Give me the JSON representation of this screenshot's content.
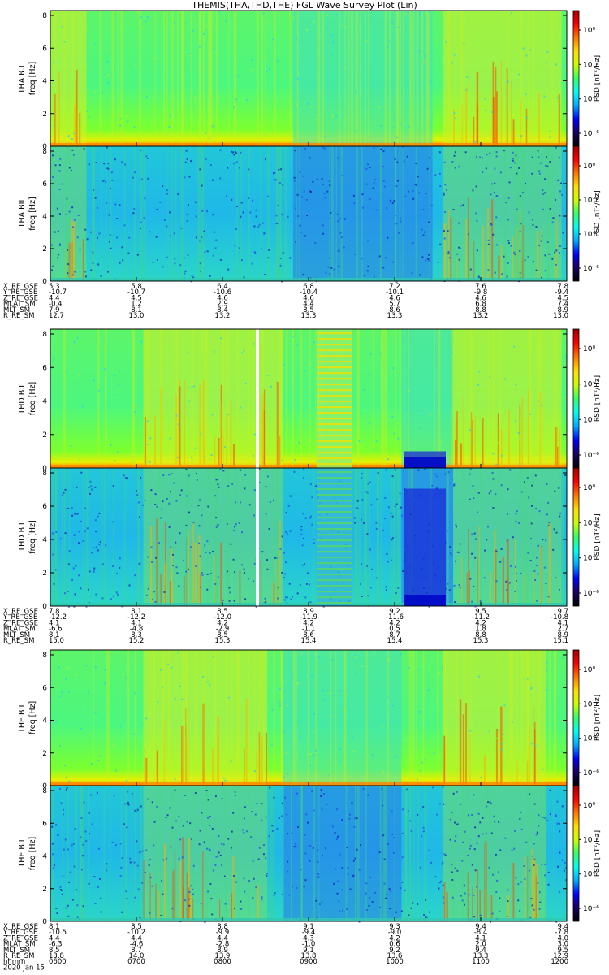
{
  "title": "THEMIS(THA,THD,THE) FGL Wave Survey Plot (Lin)",
  "colors": {
    "axis": "#000000",
    "background": "#ffffff"
  },
  "colorbar_stops": [
    "#000000",
    "#1a0060",
    "#0000ff",
    "#00aaff",
    "#00ffee",
    "#33ff66",
    "#ccff00",
    "#ffdd00",
    "#ff7700",
    "#ff0000",
    "#9b0000"
  ],
  "probes": [
    {
      "name": "THA",
      "panels": [
        {
          "label": "THA B.L",
          "ylabel": "freq [Hz]",
          "cbar_label": "PSD [nT²/Hz]",
          "cbar_ticks": [
            "10⁰",
            "10⁻²",
            "10⁻⁴",
            "10⁻⁶"
          ],
          "base": "high"
        },
        {
          "label": "THA BII",
          "ylabel": "freq [Hz]",
          "cbar_label": "PSD [nT²/Hz]",
          "cbar_ticks": [
            "10⁰",
            "10⁻²",
            "10⁻⁴",
            "10⁻⁶"
          ],
          "base": "low"
        }
      ],
      "ephemeris": [
        {
          "name": "X_RE_GSE",
          "values": [
            "5.3",
            "5.8",
            "6.4",
            "6.8",
            "7.2",
            "7.6",
            "7.8"
          ]
        },
        {
          "name": "Y_RE_GSE",
          "values": [
            "-10.7",
            "-10.7",
            "-10.6",
            "-10.4",
            "-10.1",
            "-9.8",
            "-9.4"
          ]
        },
        {
          "name": "Z_RE_GSE",
          "values": [
            "4.4",
            "4.5",
            "4.6",
            "4.6",
            "4.6",
            "4.6",
            "4.5"
          ]
        },
        {
          "name": "MLAT_SM",
          "values": [
            "-0.4",
            "1.2",
            "2.9",
            "4.4",
            "5.7",
            "6.8",
            "7.4"
          ]
        },
        {
          "name": "MLT_SM",
          "values": [
            "7.9",
            "8.1",
            "8.4",
            "8.5",
            "8.6",
            "8.8",
            "8.9"
          ]
        },
        {
          "name": "R_RE_SM",
          "values": [
            "12.7",
            "13.0",
            "13.2",
            "13.3",
            "13.3",
            "13.2",
            "13.0"
          ]
        }
      ]
    },
    {
      "name": "THD",
      "panels": [
        {
          "label": "THD B.L",
          "ylabel": "freq [Hz]",
          "cbar_label": "PSD [nT²/Hz]",
          "cbar_ticks": [
            "10⁰",
            "10⁻²",
            "10⁻⁴",
            "10⁻⁶"
          ],
          "base": "high"
        },
        {
          "label": "THD BII",
          "ylabel": "freq [Hz]",
          "cbar_label": "PSD [nT²/Hz]",
          "cbar_ticks": [
            "10⁰",
            "10⁻²",
            "10⁻⁴",
            "10⁻⁶"
          ],
          "base": "low"
        }
      ],
      "ephemeris": [
        {
          "name": "X_RE_GSE",
          "values": [
            "7.8",
            "8.1",
            "8.5",
            "8.9",
            "9.2",
            "9.5",
            "9.7"
          ]
        },
        {
          "name": "Y_RE_GSE",
          "values": [
            "-12.2",
            "-12.2",
            "-12.0",
            "-11.9",
            "-11.6",
            "-11.2",
            "-10.8"
          ]
        },
        {
          "name": "Z_RE_GSE",
          "values": [
            "4.1",
            "4.1",
            "4.2",
            "4.2",
            "4.2",
            "4.2",
            "4.1"
          ]
        },
        {
          "name": "MLAT_SM",
          "values": [
            "-6.6",
            "-4.8",
            "-2.9",
            "-1.1",
            "0.5",
            "1.8",
            "2.7"
          ]
        },
        {
          "name": "MLT_SM",
          "values": [
            "8.1",
            "8.3",
            "8.5",
            "8.6",
            "8.7",
            "8.8",
            "8.9"
          ]
        },
        {
          "name": "R_RE_SM",
          "values": [
            "15.0",
            "15.2",
            "15.3",
            "15.4",
            "15.4",
            "15.3",
            "15.1"
          ]
        }
      ]
    },
    {
      "name": "THE",
      "panels": [
        {
          "label": "THE B.L",
          "ylabel": "freq [Hz]",
          "cbar_label": "PSD [nT²/Hz]",
          "cbar_ticks": [
            "10⁰",
            "10⁻²",
            "10⁻⁴",
            "10⁻⁶"
          ],
          "base": "high"
        },
        {
          "label": "THE BII",
          "ylabel": "freq [Hz]",
          "cbar_label": "PSD [nT²/Hz]",
          "cbar_ticks": [
            "10⁰",
            "10⁻²",
            "10⁻⁴",
            "10⁻⁶"
          ],
          "base": "low"
        }
      ],
      "ephemeris": [
        {
          "name": "X_RE_GSE",
          "values": [
            "8.1",
            "8.5",
            "8.8",
            "9.1",
            "9.3",
            "9.4",
            "9.4"
          ]
        },
        {
          "name": "Y_RE_GSE",
          "values": [
            "-10.5",
            "-10.2",
            "-9.9",
            "-9.4",
            "-9.0",
            "-8.4",
            "-7.8"
          ]
        },
        {
          "name": "Z_RE_GSE",
          "values": [
            "4.4",
            "4.4",
            "4.4",
            "4.3",
            "4.2",
            "4.1",
            "4.0"
          ]
        },
        {
          "name": "MLAT_SM",
          "values": [
            "-6.3",
            "-4.6",
            "-2.8",
            "-1.0",
            "0.6",
            "2.0",
            "3.0"
          ]
        },
        {
          "name": "MLT_SM",
          "values": [
            "8.5",
            "8.7",
            "8.9",
            "9.1",
            "9.2",
            "9.4",
            "9.5"
          ]
        },
        {
          "name": "R_RE_SM",
          "values": [
            "13.8",
            "14.0",
            "13.9",
            "13.8",
            "13.6",
            "13.3",
            "12.9"
          ]
        }
      ],
      "time_rows": [
        {
          "name": "hhmm",
          "values": [
            "0600",
            "0700",
            "0800",
            "0900",
            "1000",
            "1100",
            "1200"
          ]
        },
        {
          "name": "2020 Jan 15",
          "values": []
        }
      ]
    }
  ],
  "chart_data": {
    "type": "heatmap",
    "title": "THEMIS(THA,THD,THE) FGL Wave Survey Plot (Lin)",
    "date": "2020 Jan 15",
    "x_label": "hhmm",
    "x_ticks": [
      "0600",
      "0700",
      "0800",
      "0900",
      "1000",
      "1100",
      "1200"
    ],
    "x_range": [
      "0600",
      "1200"
    ],
    "ylabel": "freq [Hz]",
    "y_range": [
      0,
      8
    ],
    "y_ticks": [
      0,
      2,
      4,
      6,
      8
    ],
    "colorbar_label": "PSD [nT²/Hz]",
    "colorbar_scale": "log",
    "colorbar_ticks": [
      "10⁰",
      "10⁻²",
      "10⁻⁴",
      "10⁻⁶"
    ],
    "panels": [
      {
        "probe": "THA",
        "name": "THA B.L",
        "dominant_level": "moderate (green)",
        "enhanced_intervals": [
          [
            "0600",
            "0610"
          ],
          [
            "1050",
            "1120"
          ]
        ]
      },
      {
        "probe": "THA",
        "name": "THA BII",
        "dominant_level": "low (cyan-blue)",
        "enhanced_intervals": [
          [
            "1050",
            "1120"
          ]
        ]
      },
      {
        "probe": "THD",
        "name": "THD B.L",
        "dominant_level": "moderate (green)",
        "enhanced_intervals": [
          [
            "0700",
            "0800"
          ],
          [
            "1100",
            "1200"
          ]
        ],
        "gap_intervals": [
          [
            "0810",
            "0812"
          ]
        ]
      },
      {
        "probe": "THD",
        "name": "THD BII",
        "dominant_level": "low (cyan-blue)",
        "enhanced_intervals": [
          [
            "0700",
            "0800"
          ]
        ],
        "gap_intervals": [
          [
            "0810",
            "0812"
          ]
        ]
      },
      {
        "probe": "THE",
        "name": "THE B.L",
        "dominant_level": "moderate (green)",
        "enhanced_intervals": [
          [
            "0720",
            "0800"
          ],
          [
            "1050",
            "1115"
          ]
        ]
      },
      {
        "probe": "THE",
        "name": "THE BII",
        "dominant_level": "low (cyan-blue)",
        "enhanced_intervals": [
          [
            "1050",
            "1115"
          ]
        ]
      }
    ]
  }
}
